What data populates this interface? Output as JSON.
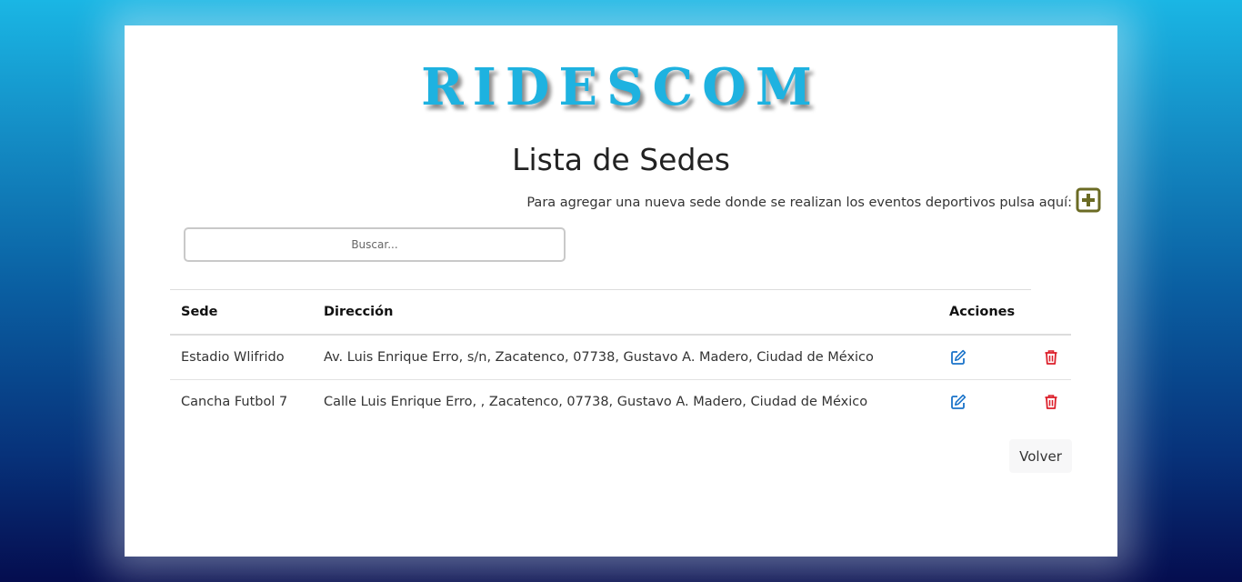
{
  "brand": {
    "logo_text": "RIDESCOM",
    "color": "#1eb2e0"
  },
  "header": {
    "title": "Lista de Sedes"
  },
  "add_prompt": {
    "text": "Para agregar una nueva sede donde se realizan los eventos deportivos pulsa aquí:",
    "icon": "plus-square-icon",
    "icon_color": "#6b6b24"
  },
  "search": {
    "placeholder": "Buscar...",
    "value": ""
  },
  "table": {
    "headers": {
      "sede": "Sede",
      "direccion": "Dirección",
      "acciones": "Acciones"
    },
    "rows": [
      {
        "sede": "Estadio Wlifrido",
        "direccion": "Av. Luis Enrique Erro, s/n, Zacatenco, 07738, Gustavo A. Madero, Ciudad de México",
        "edit_icon": "edit-icon",
        "delete_icon": "trash-icon"
      },
      {
        "sede": "Cancha Futbol 7",
        "direccion": "Calle Luis Enrique Erro, , Zacatenco, 07738, Gustavo A. Madero, Ciudad de México",
        "edit_icon": "edit-icon",
        "delete_icon": "trash-icon"
      }
    ],
    "edit_color": "#1a73c9",
    "delete_color": "#dc1f2a"
  },
  "footer": {
    "volver_label": "Volver"
  }
}
